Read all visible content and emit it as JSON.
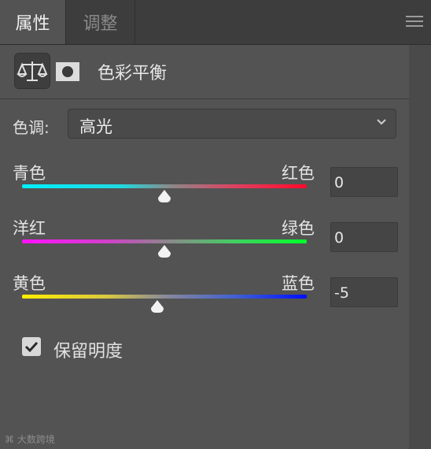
{
  "tabs": [
    {
      "label": "属性"
    },
    {
      "label": "调整"
    }
  ],
  "header": {
    "title": "色彩平衡",
    "icons": [
      "balance-scale-icon",
      "layer-mask-icon",
      "hamburger-menu-icon"
    ]
  },
  "tone": {
    "label": "色调:",
    "selected": "高光"
  },
  "sliders": [
    {
      "left": "青色",
      "right": "红色",
      "value": "0",
      "position": 0.5
    },
    {
      "left": "洋红",
      "right": "绿色",
      "value": "0",
      "position": 0.5
    },
    {
      "left": "黄色",
      "right": "蓝色",
      "value": "-5",
      "position": 0.475
    }
  ],
  "preserve_luminosity": {
    "label": "保留明度",
    "checked": true
  },
  "watermark": {
    "text": "大数跨境"
  },
  "colors": {
    "panel": "#535353",
    "cyan": "#00e5ff",
    "red": "#ff1030",
    "magenta": "#ff00ff",
    "green": "#00ff33",
    "yellow": "#ffee00",
    "blue": "#0010ff"
  }
}
